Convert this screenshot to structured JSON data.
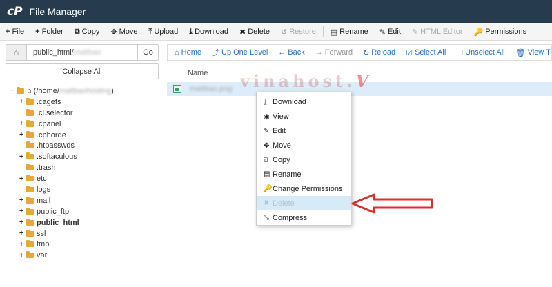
{
  "app": {
    "logo": "cP",
    "title": "File Manager"
  },
  "toolbar": [
    {
      "icon": "plus-icon",
      "glyph": "+",
      "label": "File",
      "disabled": false
    },
    {
      "icon": "plus-icon",
      "glyph": "+",
      "label": "Folder",
      "disabled": false
    },
    {
      "icon": "copy-icon",
      "glyph": "⧉",
      "label": "Copy",
      "disabled": false
    },
    {
      "icon": "move-icon",
      "glyph": "✥",
      "label": "Move",
      "disabled": false
    },
    {
      "icon": "upload-icon",
      "glyph": "⤒",
      "label": "Upload",
      "disabled": false
    },
    {
      "icon": "download-icon",
      "glyph": "⤓",
      "label": "Download",
      "disabled": false
    },
    {
      "icon": "delete-icon",
      "glyph": "✖",
      "label": "Delete",
      "disabled": false
    },
    {
      "icon": "restore-icon",
      "glyph": "↺",
      "label": "Restore",
      "disabled": true
    },
    {
      "icon": "rename-icon",
      "glyph": "▤",
      "label": "Rename",
      "disabled": false
    },
    {
      "icon": "edit-icon",
      "glyph": "✎",
      "label": "Edit",
      "disabled": false
    },
    {
      "icon": "html-editor-icon",
      "glyph": "✎",
      "label": "HTML Editor",
      "disabled": true
    },
    {
      "icon": "permissions-icon",
      "glyph": "🔑",
      "label": "Permissions",
      "disabled": false
    }
  ],
  "sidebar": {
    "path_prefix": "public_html/",
    "path_blurred": "mattbao",
    "go_label": "Go",
    "collapse_label": "Collapse All",
    "root_label_prefix": "(/home/",
    "root_label_blurred": "mattbaohosting",
    "root_label_suffix": ")",
    "tree": [
      {
        "label": ".cagefs",
        "expandable": true,
        "bold": false
      },
      {
        "label": ".cl.selector",
        "expandable": false,
        "bold": false
      },
      {
        "label": ".cpanel",
        "expandable": true,
        "bold": false
      },
      {
        "label": ".cphorde",
        "expandable": true,
        "bold": false
      },
      {
        "label": ".htpasswds",
        "expandable": false,
        "bold": false
      },
      {
        "label": ".softaculous",
        "expandable": true,
        "bold": false
      },
      {
        "label": ".trash",
        "expandable": false,
        "bold": false
      },
      {
        "label": "etc",
        "expandable": true,
        "bold": false
      },
      {
        "label": "logs",
        "expandable": false,
        "bold": false
      },
      {
        "label": "mail",
        "expandable": true,
        "bold": false
      },
      {
        "label": "public_ftp",
        "expandable": true,
        "bold": false
      },
      {
        "label": "public_html",
        "expandable": true,
        "bold": true
      },
      {
        "label": "ssl",
        "expandable": true,
        "bold": false
      },
      {
        "label": "tmp",
        "expandable": true,
        "bold": false
      },
      {
        "label": "var",
        "expandable": true,
        "bold": false
      }
    ]
  },
  "navbar": [
    {
      "icon": "home-icon",
      "glyph": "⌂",
      "label": "Home",
      "disabled": false
    },
    {
      "icon": "up-level-icon",
      "glyph": "⤴",
      "label": "Up One Level",
      "disabled": false
    },
    {
      "icon": "back-icon",
      "glyph": "←",
      "label": "Back",
      "disabled": false
    },
    {
      "icon": "forward-icon",
      "glyph": "→",
      "label": "Forward",
      "disabled": true
    },
    {
      "icon": "reload-icon",
      "glyph": "↻",
      "label": "Reload",
      "disabled": false
    },
    {
      "icon": "select-all-icon",
      "glyph": "☑",
      "label": "Select All",
      "disabled": false
    },
    {
      "icon": "unselect-all-icon",
      "glyph": "☐",
      "label": "Unselect All",
      "disabled": false
    },
    {
      "icon": "trash-icon",
      "glyph": "🗑",
      "label": "View Tras",
      "disabled": false
    }
  ],
  "list": {
    "column_name": "Name",
    "file_name": "mattbao.png"
  },
  "watermark": {
    "text": "vinahost.",
    "mark": "V"
  },
  "context_menu": [
    {
      "icon": "download-icon",
      "glyph": "⤓",
      "label": "Download",
      "highlighted": false
    },
    {
      "icon": "view-icon",
      "glyph": "◉",
      "label": "View",
      "highlighted": false
    },
    {
      "icon": "edit-icon",
      "glyph": "✎",
      "label": "Edit",
      "highlighted": false
    },
    {
      "icon": "move-icon",
      "glyph": "✥",
      "label": "Move",
      "highlighted": false
    },
    {
      "icon": "copy-icon",
      "glyph": "⧉",
      "label": "Copy",
      "highlighted": false
    },
    {
      "icon": "rename-icon",
      "glyph": "▤",
      "label": "Rename",
      "highlighted": false
    },
    {
      "icon": "permissions-icon",
      "glyph": "🔑",
      "label": "Change Permissions",
      "highlighted": false
    },
    {
      "icon": "delete-icon",
      "glyph": "✖",
      "label": "Delete",
      "highlighted": true
    },
    {
      "icon": "compress-icon",
      "glyph": "⤡",
      "label": "Compress",
      "highlighted": false
    }
  ],
  "colors": {
    "titlebar": "#263b4e",
    "link": "#2a70c4",
    "folder": "#e8a838",
    "selection": "#dcecf8",
    "arrow": "#d9302c"
  }
}
